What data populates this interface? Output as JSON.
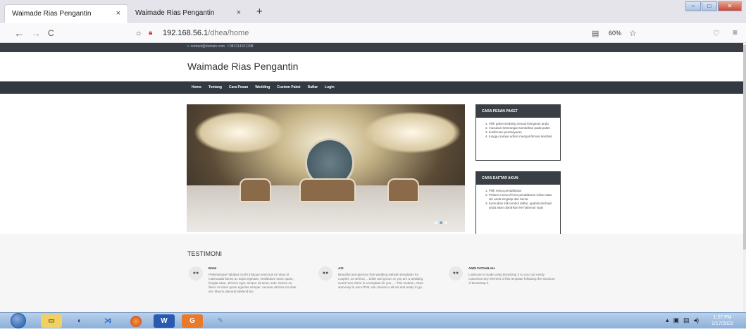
{
  "browser": {
    "tabs": [
      {
        "label": "Waimade Rias Pengantin",
        "close": "×"
      },
      {
        "label": "Waimade Rias Pengantin",
        "close": "×"
      }
    ],
    "new_tab": "+",
    "url_host": "192.168.56.1",
    "url_path": "/dhea/home",
    "zoom": "60%",
    "icons": {
      "back": "←",
      "forward": "→",
      "reload": "C",
      "star": "☆",
      "pocket": "♡",
      "menu": "≡",
      "reader": "▤",
      "shield": "○",
      "lock": "🔒"
    }
  },
  "site": {
    "contact_email": "contact@domain.com",
    "contact_phone": "081214021298",
    "brand": "Waimade Rias Pengantin",
    "menu": [
      "Home",
      "Tentang",
      "Cara Pesan",
      "Wedding",
      "Custom Paket",
      "Daftar",
      "Login"
    ],
    "panels": [
      {
        "title": "CARA PESAN PAKET",
        "items": [
          "Pilih paket wedding sesuai keinginan anda",
          "masukan keterangan tambahan pada paket",
          "konfirmasi pembayaran",
          "tunggu sampe admin mengonfirmasi kembali"
        ]
      },
      {
        "title": "CARA DAFTAR AKUN",
        "items": [
          "Pilih menu pendaftaran",
          "Pelanin muncul form pendaftaran isikan data diri anda lengkap dan benar",
          "Kemudian klik tombol daftar, apabila berhasil anda akan diarahkan ke halaman login"
        ]
      }
    ],
    "testimoni_title": "TESTIMONI",
    "testimonials": [
      {
        "name": "BANI",
        "text": "Pellentesque habitant morbi tristique senectus et netus et malesuada fames ac turpis egestas. Vestibulum tortor quam, feugiat vitae, ultricies eget, tempor sit amet, ante. Donec eu libero sit amet quam egestas semper. Aenean ultricies mi vitae est. Mauris placerat eleifend leo."
      },
      {
        "name": "ASI",
        "text": "Beautiful and glorious free wedding website templates for couples, as well as ... bride and groom or you are a wedding event host, there is a template for you. ... This modern, clean and easy to use HTML site canvas is all set and ready to go."
      },
      {
        "name": "ANDI FATAHILAH",
        "text": "Lodecare is made using Bootstrap 3 so you can easily customize any element of this template following the structure of Bootstrap 3."
      }
    ]
  },
  "taskbar": {
    "time": "1:27 PM",
    "date": "1/17/2022"
  }
}
